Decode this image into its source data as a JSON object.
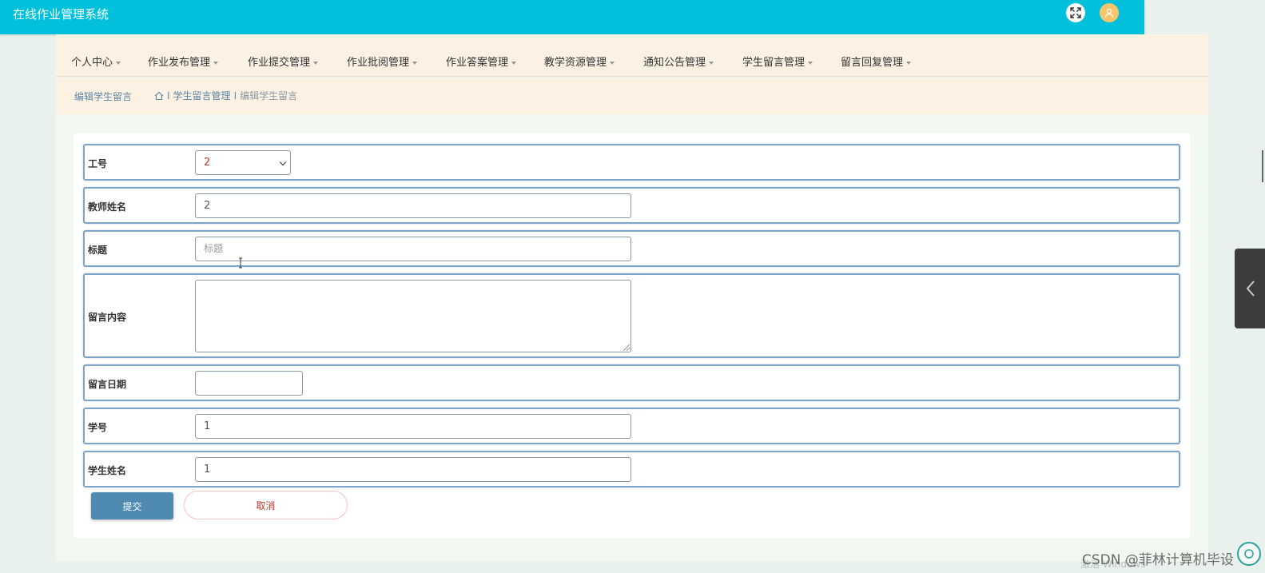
{
  "app": {
    "title": "在线作业管理系统"
  },
  "colors": {
    "header": "#00c0dc",
    "nav_bg": "#fdf1e3",
    "submit": "#4f8ab1",
    "cancel_text": "#c0392b",
    "field_border": "#7ea5c8"
  },
  "header": {
    "fullscreen_icon": "expand-icon",
    "avatar_icon": "user-icon"
  },
  "nav": {
    "items": [
      {
        "label": "个人中心"
      },
      {
        "label": "作业发布管理"
      },
      {
        "label": "作业提交管理"
      },
      {
        "label": "作业批阅管理"
      },
      {
        "label": "作业答案管理"
      },
      {
        "label": "教学资源管理"
      },
      {
        "label": "通知公告管理"
      },
      {
        "label": "学生留言管理"
      },
      {
        "label": "留言回复管理"
      }
    ]
  },
  "breadcrumb": {
    "page_title": "编辑学生留言",
    "separator": "I",
    "section": "学生留言管理",
    "current": "编辑学生留言"
  },
  "form": {
    "fields": {
      "teacher_id": {
        "label": "工号",
        "value": "2"
      },
      "teacher_name": {
        "label": "教师姓名",
        "value": "2"
      },
      "title": {
        "label": "标题",
        "placeholder": "标题",
        "value": ""
      },
      "content": {
        "label": "留言内容",
        "value": ""
      },
      "date": {
        "label": "留言日期",
        "value": ""
      },
      "student_id": {
        "label": "学号",
        "value": "1"
      },
      "student_name": {
        "label": "学生姓名",
        "value": "1"
      }
    },
    "submit_label": "提交",
    "cancel_label": "取消"
  },
  "overlay": {
    "watermark": "CSDN @菲林计算机毕设",
    "watermark_faint": "激活 Windows"
  }
}
